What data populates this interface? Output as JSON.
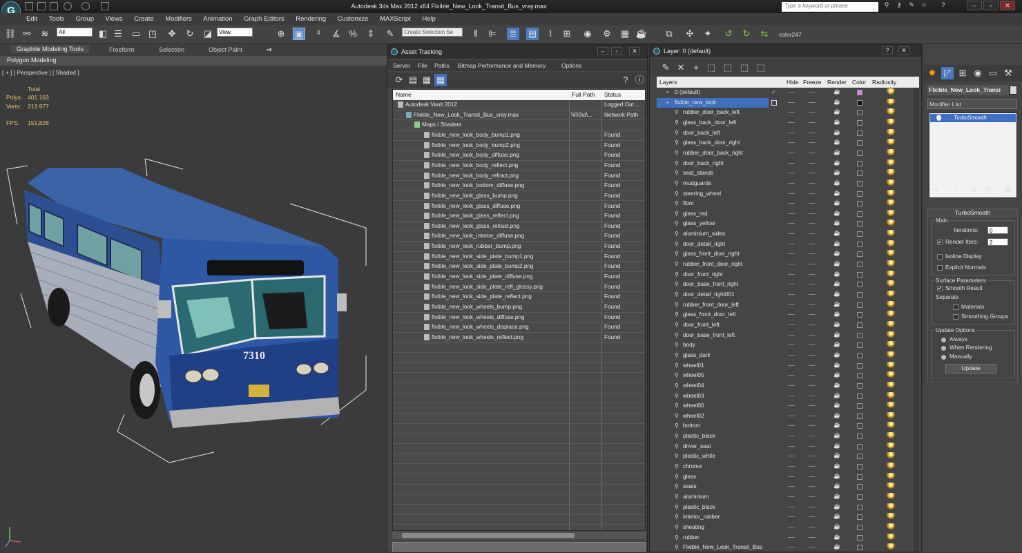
{
  "app": {
    "title": "Autodesk 3ds Max  2012 x64      Flxible_New_Look_Transit_Bus_vray.max",
    "search_placeholder": "Type a keyword or phrase"
  },
  "menu": [
    "Edit",
    "Tools",
    "Group",
    "Views",
    "Create",
    "Modifiers",
    "Animation",
    "Graph Editors",
    "Rendering",
    "Customize",
    "MAXScript",
    "Help"
  ],
  "toolbar": {
    "filter_value": "All",
    "refcoord_value": "View",
    "selection_set_placeholder": "Create Selection Se",
    "color_label": "color247"
  },
  "ribbon": {
    "tabs": [
      "Graphite Modeling Tools",
      "Freeform",
      "Selection",
      "Object Paint"
    ],
    "sub": "Polygon Modeling"
  },
  "viewport": {
    "label": "[ + ] [ Perspective ] [ Shaded ]",
    "stats": {
      "total_label": "Total",
      "polys_label": "Polys:",
      "polys_value": "401 163",
      "verts_label": "Verts:",
      "verts_value": "213 977",
      "fps_label": "FPS:",
      "fps_value": "151,828"
    },
    "bus_number": "7310"
  },
  "asset_tracking": {
    "title": "Asset Tracking",
    "menu": [
      "Server",
      "File",
      "Paths",
      "Bitmap Performance and Memory",
      "Options"
    ],
    "columns": [
      "Name",
      "Full Path",
      "Status"
    ],
    "rows": [
      {
        "name": "Autodesk Vault 2012",
        "path": "",
        "status": "Logged Out ...",
        "indent": 0
      },
      {
        "name": "Flxible_New_Look_Transit_Bus_vray.max",
        "path": "\\\\R0\\d\\...",
        "status": "Network Path",
        "indent": 1
      },
      {
        "name": "Maps / Shaders",
        "path": "",
        "status": "",
        "indent": 2
      },
      {
        "name": "flxible_new_look_body_bump1.png",
        "path": "",
        "status": "Found",
        "indent": 3
      },
      {
        "name": "flxible_new_look_body_bump2.png",
        "path": "",
        "status": "Found",
        "indent": 3
      },
      {
        "name": "flxible_new_look_body_diffuse.png",
        "path": "",
        "status": "Found",
        "indent": 3
      },
      {
        "name": "flxible_new_look_body_reflect.png",
        "path": "",
        "status": "Found",
        "indent": 3
      },
      {
        "name": "flxible_new_look_body_refract.png",
        "path": "",
        "status": "Found",
        "indent": 3
      },
      {
        "name": "flxible_new_look_bottom_diffuse.png",
        "path": "",
        "status": "Found",
        "indent": 3
      },
      {
        "name": "flxible_new_look_glass_bump.png",
        "path": "",
        "status": "Found",
        "indent": 3
      },
      {
        "name": "flxible_new_look_glass_diffuse.png",
        "path": "",
        "status": "Found",
        "indent": 3
      },
      {
        "name": "flxible_new_look_glass_reflect.png",
        "path": "",
        "status": "Found",
        "indent": 3
      },
      {
        "name": "flxible_new_look_glass_refract.png",
        "path": "",
        "status": "Found",
        "indent": 3
      },
      {
        "name": "flxible_new_look_interior_diffuse.png",
        "path": "",
        "status": "Found",
        "indent": 3
      },
      {
        "name": "flxible_new_look_rubber_bump.png",
        "path": "",
        "status": "Found",
        "indent": 3
      },
      {
        "name": "flxible_new_look_side_plate_bump1.png",
        "path": "",
        "status": "Found",
        "indent": 3
      },
      {
        "name": "flxible_new_look_side_plate_bump2.png",
        "path": "",
        "status": "Found",
        "indent": 3
      },
      {
        "name": "flxible_new_look_side_plate_diffuse.png",
        "path": "",
        "status": "Found",
        "indent": 3
      },
      {
        "name": "flxible_new_look_side_plate_refl_glossy.png",
        "path": "",
        "status": "Found",
        "indent": 3
      },
      {
        "name": "flxible_new_look_side_plate_reflect.png",
        "path": "",
        "status": "Found",
        "indent": 3
      },
      {
        "name": "flxible_new_look_wheels_bump.png",
        "path": "",
        "status": "Found",
        "indent": 3
      },
      {
        "name": "flxible_new_look_wheels_diffuse.png",
        "path": "",
        "status": "Found",
        "indent": 3
      },
      {
        "name": "flxible_new_look_wheels_displace.png",
        "path": "",
        "status": "Found",
        "indent": 3
      },
      {
        "name": "flxible_new_look_wheels_reflect.png",
        "path": "",
        "status": "Found",
        "indent": 3
      }
    ]
  },
  "layers": {
    "title": "Layer: 0 (default)",
    "columns": [
      "Layers",
      "Hide",
      "Freeze",
      "Render",
      "Color",
      "Radiosity"
    ],
    "rows": [
      {
        "name": "0 (default)",
        "level": 0,
        "color": "#e080e0",
        "check": true
      },
      {
        "name": "flxible_new_look",
        "level": 0,
        "color": "#111111",
        "selected": true
      },
      {
        "name": "rubber_door_back_left",
        "level": 1
      },
      {
        "name": "glass_back_door_left",
        "level": 1
      },
      {
        "name": "door_back_left",
        "level": 1
      },
      {
        "name": "glass_back_door_right",
        "level": 1
      },
      {
        "name": "rubber_door_back_right",
        "level": 1
      },
      {
        "name": "door_back_right",
        "level": 1
      },
      {
        "name": "seat_stands",
        "level": 1
      },
      {
        "name": "mudguards",
        "level": 1
      },
      {
        "name": "steering_wheel",
        "level": 1
      },
      {
        "name": "floor",
        "level": 1
      },
      {
        "name": "glass_red",
        "level": 1
      },
      {
        "name": "glass_yellow",
        "level": 1
      },
      {
        "name": "aluminium_sides",
        "level": 1
      },
      {
        "name": "door_detail_right",
        "level": 1
      },
      {
        "name": "glass_front_door_right",
        "level": 1
      },
      {
        "name": "rubber_front_door_right",
        "level": 1
      },
      {
        "name": "door_front_right",
        "level": 1
      },
      {
        "name": "door_base_front_right",
        "level": 1
      },
      {
        "name": "door_detail_right001",
        "level": 1
      },
      {
        "name": "rubber_front_door_left",
        "level": 1
      },
      {
        "name": "glass_front_door_left",
        "level": 1
      },
      {
        "name": "door_front_left",
        "level": 1
      },
      {
        "name": "door_base_front_left",
        "level": 1
      },
      {
        "name": "body",
        "level": 1
      },
      {
        "name": "glass_dark",
        "level": 1
      },
      {
        "name": "wheel01",
        "level": 1
      },
      {
        "name": "wheel05",
        "level": 1
      },
      {
        "name": "wheel04",
        "level": 1
      },
      {
        "name": "wheel03",
        "level": 1
      },
      {
        "name": "wheel00",
        "level": 1
      },
      {
        "name": "wheel02",
        "level": 1
      },
      {
        "name": "bottom",
        "level": 1
      },
      {
        "name": "plastic_black",
        "level": 1
      },
      {
        "name": "driver_seat",
        "level": 1
      },
      {
        "name": "plastic_white",
        "level": 1
      },
      {
        "name": "chrome",
        "level": 1
      },
      {
        "name": "glass",
        "level": 1
      },
      {
        "name": "seats",
        "level": 1
      },
      {
        "name": "aluminium",
        "level": 1
      },
      {
        "name": "plastic_black",
        "level": 1
      },
      {
        "name": "interior_rubber",
        "level": 1
      },
      {
        "name": "sheating",
        "level": 1
      },
      {
        "name": "rubber",
        "level": 1
      },
      {
        "name": "Flxible_New_Look_Transit_Bus",
        "level": 1
      }
    ]
  },
  "command_panel": {
    "object_name": "Flxible_New_Look_Transi",
    "modifier_list": "Modifier List",
    "stack_item": "TurboSmooth",
    "rollout_title": "TurboSmooth",
    "main_label": "Main",
    "iterations_label": "Iterations:",
    "iterations_value": "0",
    "render_iters_label": "Render Iters:",
    "render_iters_value": "2",
    "isoline_label": "Isoline Display",
    "explicit_label": "Explicit Normals",
    "surface_label": "Surface Parameters",
    "smooth_label": "Smooth Result",
    "separate_label": "Separate",
    "materials_label": "Materials",
    "smoothing_groups_label": "Smoothing Groups",
    "update_options_label": "Update Options",
    "always_label": "Always",
    "when_rendering_label": "When Rendering",
    "manually_label": "Manually",
    "update_button": "Update"
  }
}
